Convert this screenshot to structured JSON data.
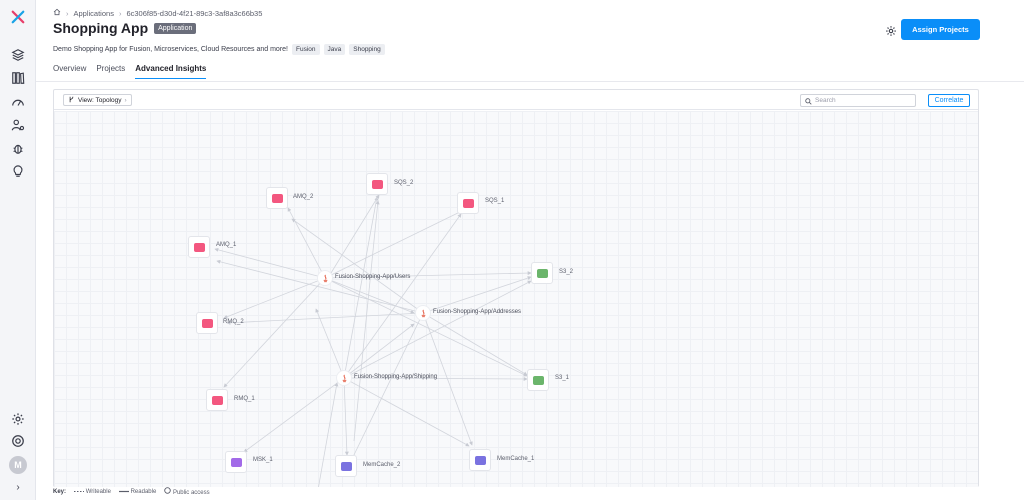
{
  "nav": {
    "icons": [
      "harness-logo-icon",
      "layers-icon",
      "library-icon",
      "gauge-icon",
      "users-gear-icon",
      "bug-icon",
      "lightbulb-icon"
    ],
    "bottom_icons": [
      "settings-icon",
      "help-icon"
    ],
    "avatar_initial": "M",
    "expand_icon": "chevron-right-icon"
  },
  "breadcrumb": {
    "home_icon": "home-icon",
    "items": [
      "Applications",
      "6c306f85-d30d-4f21-89c3-3af8a3c66b35"
    ]
  },
  "header": {
    "title": "Shopping App",
    "badge": "Application",
    "description": "Demo Shopping App for Fusion, Microservices, Cloud Resources and more!",
    "tags": [
      "Fusion",
      "Java",
      "Shopping"
    ],
    "assign_label": "Assign Projects"
  },
  "tabs": [
    "Overview",
    "Projects",
    "Advanced Insights"
  ],
  "active_tab": "Advanced Insights",
  "toolbar": {
    "view_label": "View: Topology",
    "search_placeholder": "Search",
    "correlate_label": "Correlate"
  },
  "topology": {
    "services": [
      {
        "id": "users",
        "label": "Fusion-Shopping-App/Users"
      },
      {
        "id": "addresses",
        "label": "Fusion-Shopping-App/Addresses"
      },
      {
        "id": "shipping",
        "label": "Fusion-Shopping-App/Shipping"
      }
    ],
    "resources": [
      {
        "id": "sqs2",
        "label": "SQS_2",
        "kind": "queue",
        "color": "#f3577f"
      },
      {
        "id": "amq2",
        "label": "AMQ_2",
        "kind": "queue",
        "color": "#f3577f"
      },
      {
        "id": "sqs1",
        "label": "SQS_1",
        "kind": "queue",
        "color": "#f3577f"
      },
      {
        "id": "amq1",
        "label": "AMQ_1",
        "kind": "queue",
        "color": "#f3577f"
      },
      {
        "id": "s32",
        "label": "S3_2",
        "kind": "storage",
        "color": "#6bb56b"
      },
      {
        "id": "rmq2",
        "label": "RMQ_2",
        "kind": "queue",
        "color": "#f3577f"
      },
      {
        "id": "s31",
        "label": "S3_1",
        "kind": "storage",
        "color": "#6bb56b"
      },
      {
        "id": "rmq1",
        "label": "RMQ_1",
        "kind": "queue",
        "color": "#f3577f"
      },
      {
        "id": "msk1",
        "label": "MSK_1",
        "kind": "stream",
        "color": "#a26ae8"
      },
      {
        "id": "memcache2",
        "label": "MemCache_2",
        "kind": "cache",
        "color": "#7a72e0"
      },
      {
        "id": "memcache1",
        "label": "MemCache_1",
        "kind": "cache",
        "color": "#7a72e0"
      }
    ]
  },
  "key": {
    "label": "Key:",
    "items": [
      "Writeable",
      "Readable",
      "Public access"
    ]
  },
  "colors": {
    "accent": "#0a8ef8",
    "queue": "#f3577f",
    "storage": "#6bb56b",
    "cache": "#7a72e0",
    "stream": "#a26ae8",
    "service": "#e2533a"
  }
}
